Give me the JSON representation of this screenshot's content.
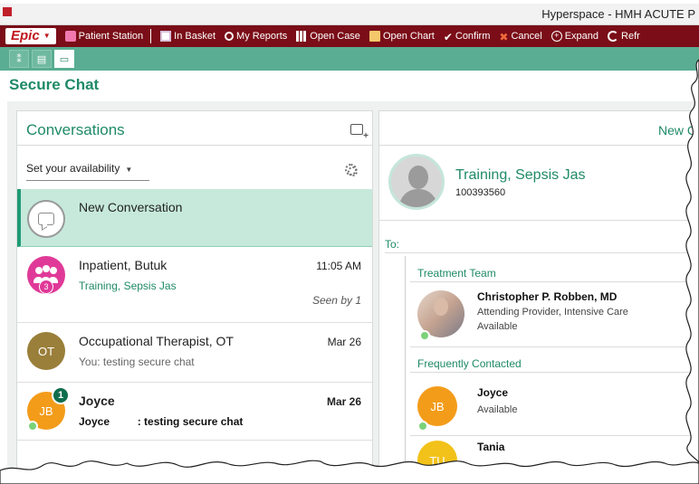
{
  "window": {
    "title": "Hyperspace - HMH ACUTE P"
  },
  "toolbar": {
    "logo": "Epic",
    "items": [
      {
        "label": "Patient Station",
        "icon": "patient-station-icon"
      },
      {
        "label": "In Basket",
        "icon": "in-basket-icon"
      },
      {
        "label": "My Reports",
        "icon": "search-icon"
      },
      {
        "label": "Open Case",
        "icon": "grid-icon"
      },
      {
        "label": "Open Chart",
        "icon": "folder-icon"
      },
      {
        "label": "Confirm",
        "icon": "checkmark-icon"
      },
      {
        "label": "Cancel",
        "icon": "x-icon"
      },
      {
        "label": "Expand",
        "icon": "plus-circle-icon"
      },
      {
        "label": "Refr",
        "icon": "refresh-icon"
      }
    ]
  },
  "activity_tabs": [
    {
      "icon": "people-list-icon",
      "glyph": "⁑"
    },
    {
      "icon": "chart-window-icon",
      "glyph": "▤"
    },
    {
      "icon": "chat-bubble-icon",
      "glyph": "▭"
    }
  ],
  "page": {
    "title": "Secure Chat"
  },
  "conversations": {
    "header": "Conversations",
    "availability": "Set your availability",
    "items": [
      {
        "name": "New Conversation",
        "sub": "",
        "time": "",
        "seen": ""
      },
      {
        "name": "Inpatient, Butuk",
        "sub": "Training, Sepsis Jas",
        "time": "11:05 AM",
        "seen": "Seen by 1",
        "count": "3"
      },
      {
        "name": "Occupational Therapist, OT",
        "sub": "You: testing secure chat",
        "time": "Mar 26",
        "seen": "",
        "initials": "OT"
      },
      {
        "name": "Joyce",
        "sub_sender": "Joyce",
        "sub": ": testing secure chat",
        "time": "Mar 26",
        "seen": "",
        "initials": "JB",
        "unread": "1"
      }
    ]
  },
  "new_conversation": {
    "header": "New C",
    "patient": {
      "name": "Training, Sepsis Jas",
      "mrn": "100393560"
    },
    "to_label": "To:",
    "treatment_team": {
      "header": "Treatment Team",
      "members": [
        {
          "name": "Christopher P. Robben, MD",
          "role": "Attending Provider, Intensive Care",
          "status": "Available"
        }
      ]
    },
    "frequently_contacted": {
      "header": "Frequently Contacted",
      "members": [
        {
          "name": "Joyce",
          "status": "Available",
          "initials": "JB"
        },
        {
          "name": "Tania",
          "status": "",
          "initials": "TU"
        }
      ]
    }
  },
  "colors": {
    "epic_bar": "#7a0d18",
    "tab_bar": "#5aad92",
    "accent_green": "#1f8a68",
    "selected_row": "#c6e9dc",
    "group_pink": "#e03a98",
    "ot_brown": "#9a7f3a",
    "jb_orange": "#f39c1a",
    "tu_yellow": "#f2c21a",
    "badge_green": "#0f6d4d",
    "available_dot": "#7cd27a"
  }
}
